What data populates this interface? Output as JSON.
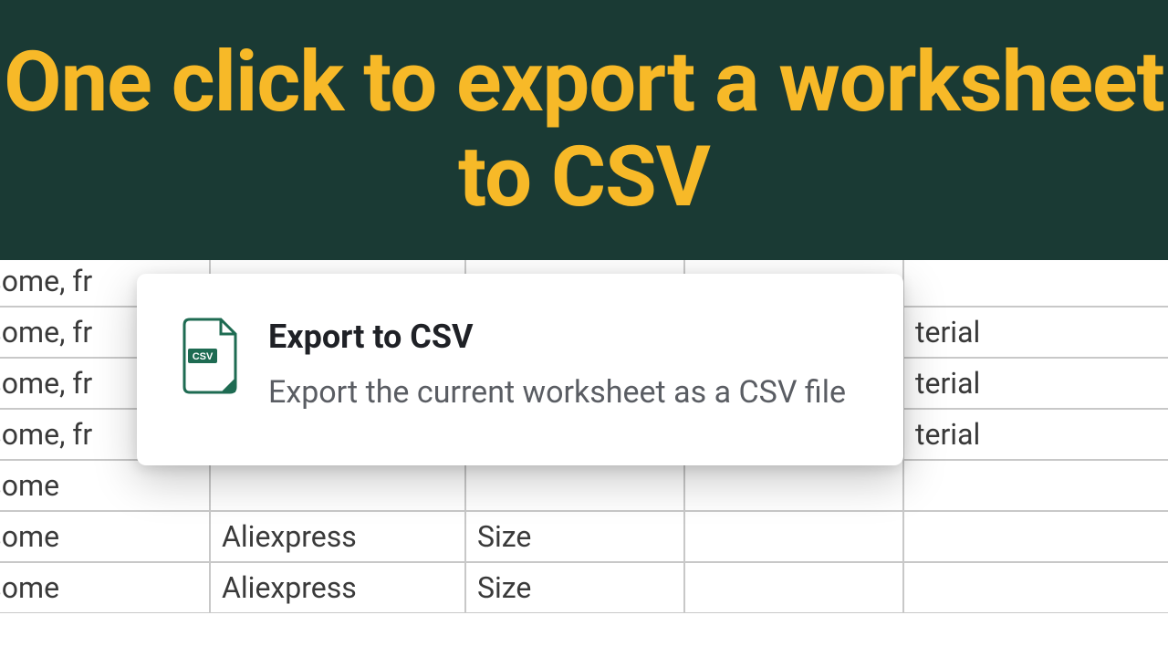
{
  "header": {
    "title": "One click to export a worksheet to CSV"
  },
  "popup": {
    "title": "Export to CSV",
    "description": "Export the current worksheet as a CSV file",
    "icon_badge": "CSV"
  },
  "spreadsheet": {
    "rows": [
      {
        "a": "vesome, fr",
        "b": "",
        "c": "",
        "d": "",
        "e": ""
      },
      {
        "a": "vesome, fr",
        "b": "",
        "c": "",
        "d": "",
        "e": "terial"
      },
      {
        "a": "vesome, fr",
        "b": "",
        "c": "",
        "d": "",
        "e": "terial"
      },
      {
        "a": "vesome, fr",
        "b": "",
        "c": "",
        "d": "",
        "e": "terial"
      },
      {
        "a": "vesome",
        "b": "",
        "c": "",
        "d": "",
        "e": ""
      },
      {
        "a": "vesome",
        "b": "Aliexpress",
        "c": "Size",
        "d": "",
        "e": ""
      },
      {
        "a": "vesome",
        "b": "Aliexpress",
        "c": "Size",
        "d": "",
        "e": ""
      }
    ]
  }
}
